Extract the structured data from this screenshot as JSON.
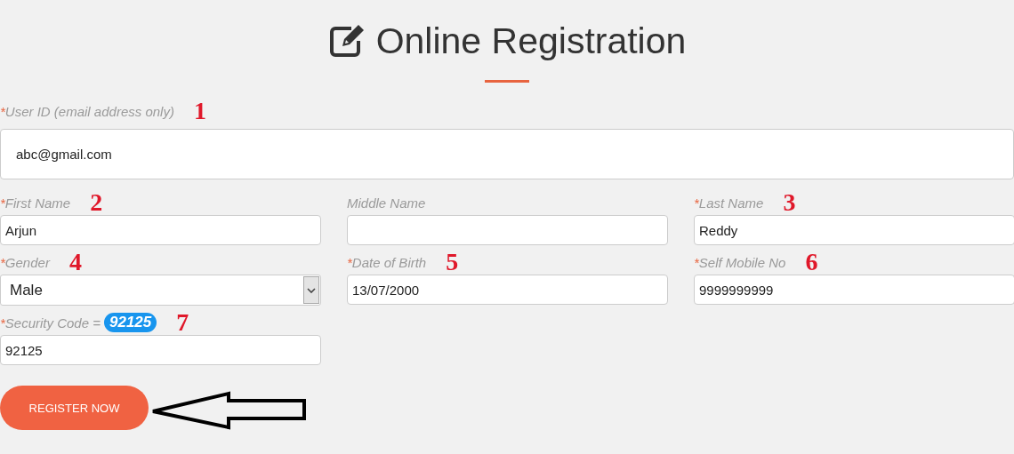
{
  "title": "Online Registration",
  "user_id": {
    "asterisk": "*",
    "label": "User ID (email address only)",
    "marker": "1",
    "value": "abc@gmail.com"
  },
  "fields": [
    {
      "kind": "text",
      "asterisk": "*",
      "label": "First Name",
      "marker": "2",
      "value": "Arjun"
    },
    {
      "kind": "text",
      "label": "Middle Name"
    },
    {
      "kind": "text",
      "asterisk": "*",
      "label": "Last Name",
      "marker": "3",
      "value": "Reddy"
    },
    {
      "kind": "select",
      "asterisk": "*",
      "label": "Gender",
      "marker": "4",
      "value": "Male"
    },
    {
      "kind": "text",
      "asterisk": "*",
      "label": "Date of Birth",
      "marker": "5",
      "value": "13/07/2000"
    },
    {
      "kind": "text",
      "asterisk": "*",
      "label": "Self Mobile No",
      "marker": "6",
      "value": "9999999999"
    },
    {
      "kind": "captcha",
      "asterisk": "*",
      "label": "Security Code =",
      "code": "92125",
      "marker": "7",
      "value": "92125"
    }
  ],
  "submit": {
    "label": "REGISTER NOW"
  }
}
